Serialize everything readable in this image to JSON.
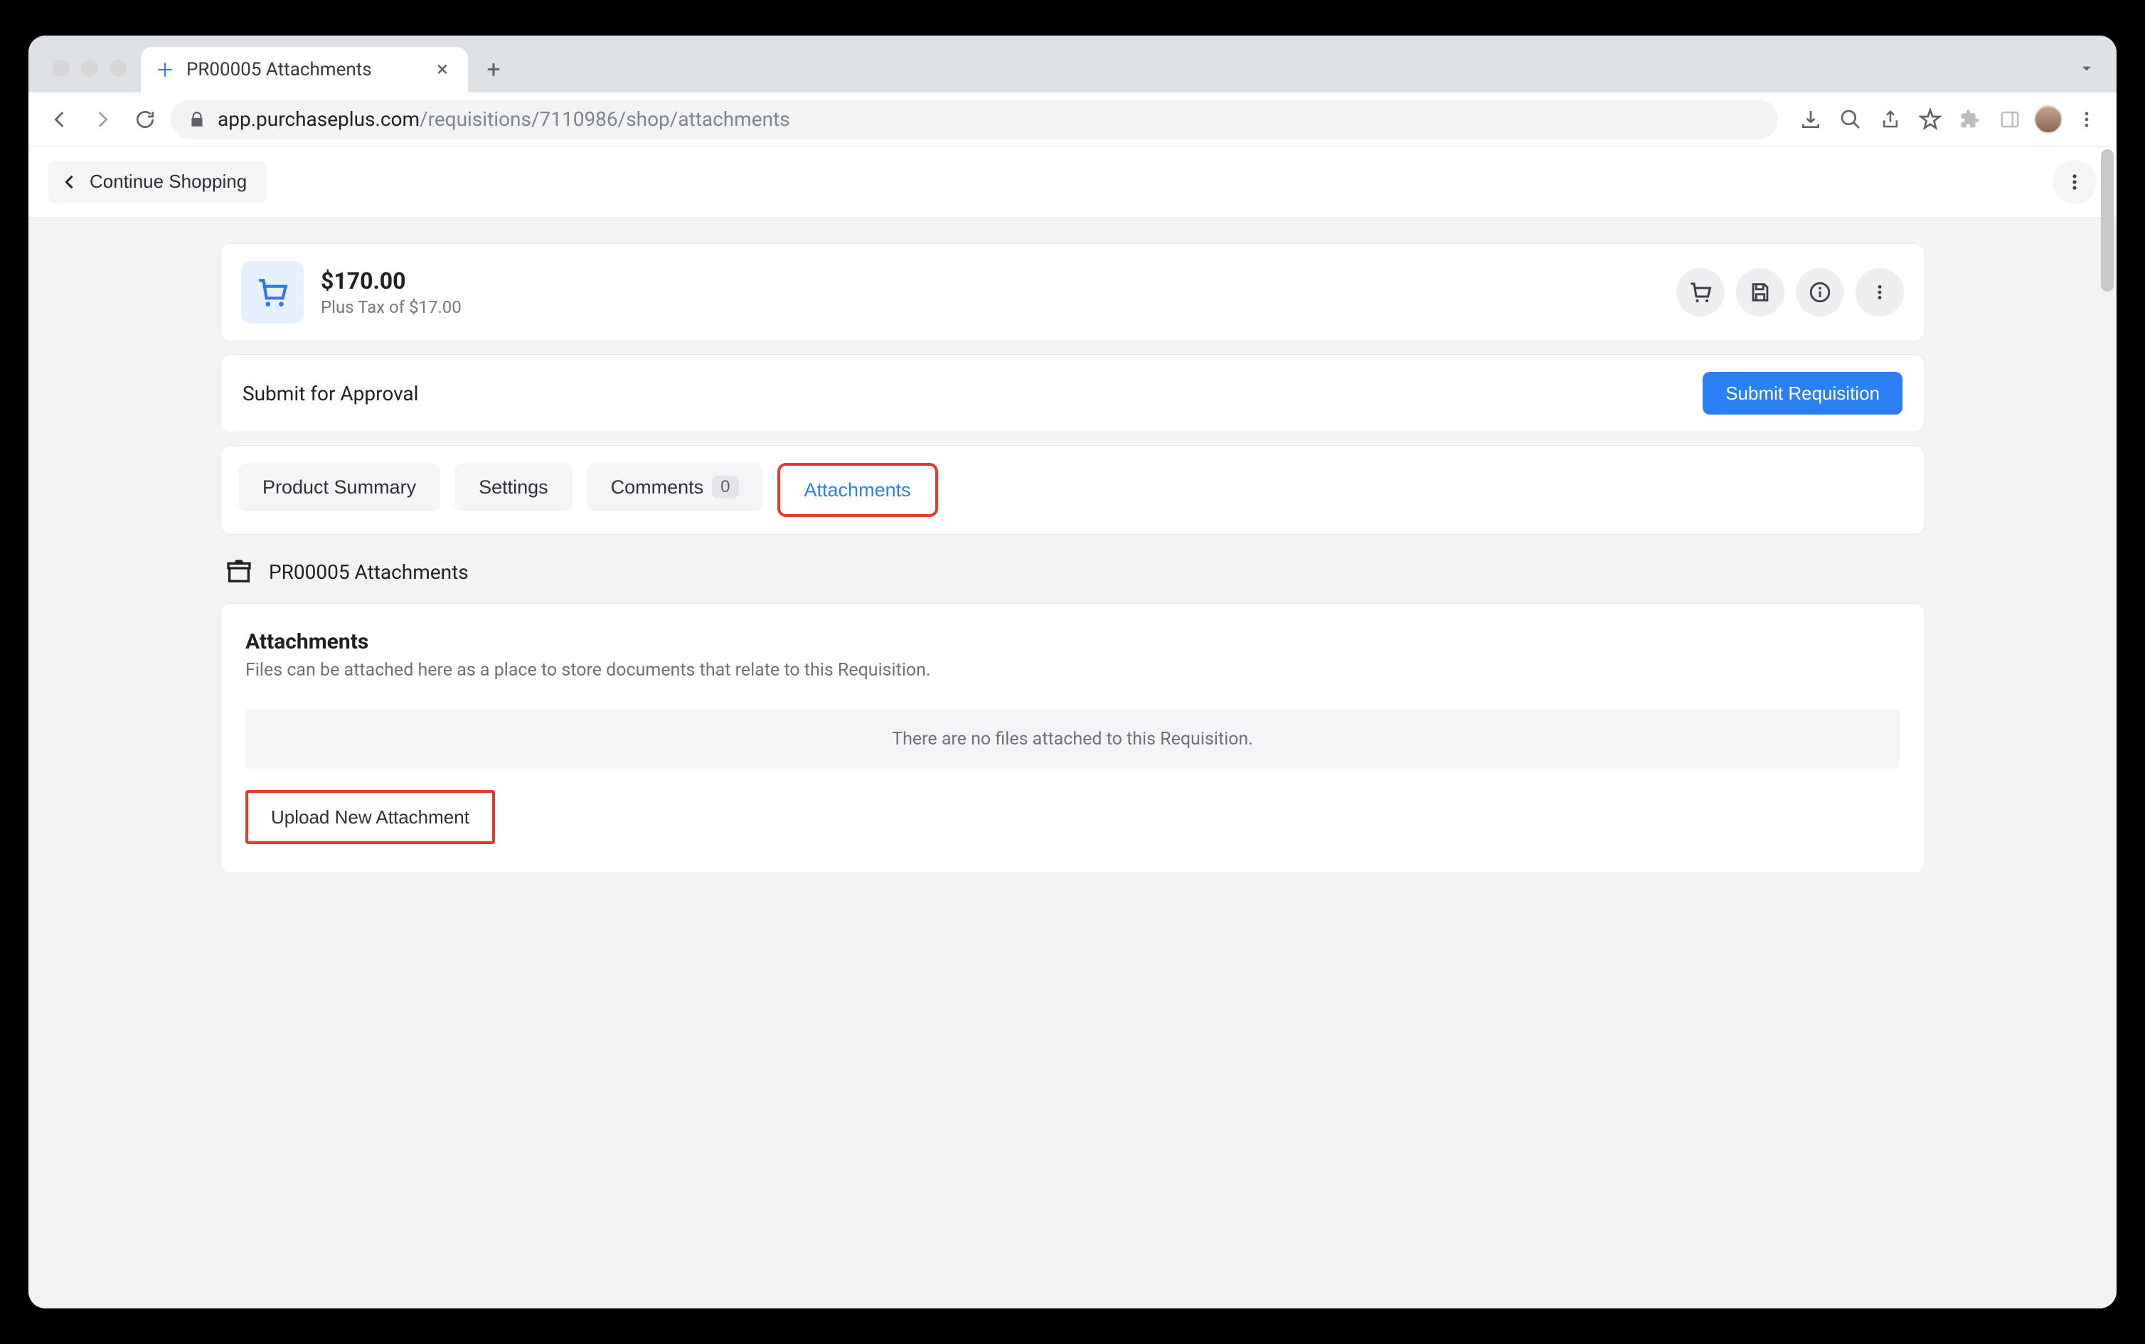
{
  "browser": {
    "tab_title": "PR00005 Attachments",
    "url_host": "app.purchaseplus.com",
    "url_path": "/requisitions/7110986/shop/attachments"
  },
  "header": {
    "continue_shopping": "Continue Shopping"
  },
  "summary": {
    "amount": "$170.00",
    "tax_line": "Plus Tax of $17.00"
  },
  "approval": {
    "label": "Submit for Approval",
    "submit_button": "Submit Requisition"
  },
  "tabs": {
    "product_summary": "Product Summary",
    "settings": "Settings",
    "comments": "Comments",
    "comments_count": "0",
    "attachments": "Attachments"
  },
  "section": {
    "title": "PR00005 Attachments"
  },
  "attachments": {
    "heading": "Attachments",
    "description": "Files can be attached here as a place to store documents that relate to this Requisition.",
    "empty_message": "There are no files attached to this Requisition.",
    "upload_button": "Upload New Attachment"
  }
}
